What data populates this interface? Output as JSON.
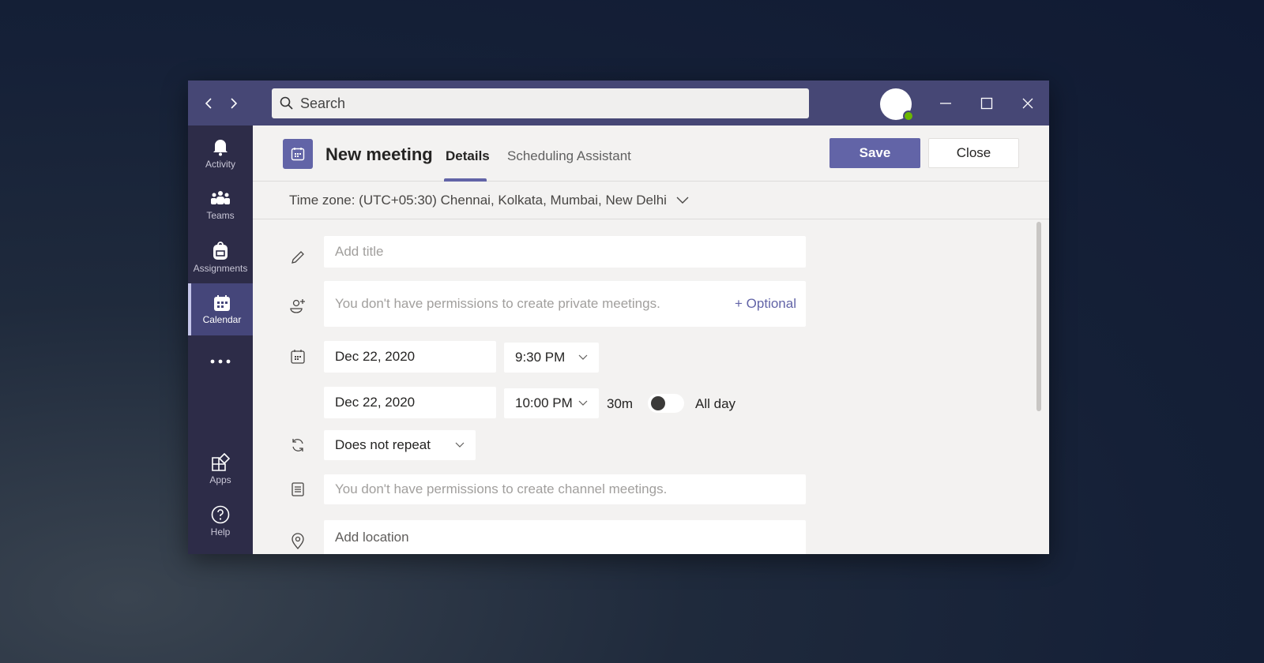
{
  "titlebar": {
    "back_label": "Back",
    "forward_label": "Forward",
    "search_placeholder": "Search",
    "presence_status": "Available",
    "window_controls": [
      "minimize",
      "maximize",
      "close"
    ]
  },
  "rail": {
    "items": [
      {
        "label": "Activity",
        "icon": "bell-icon"
      },
      {
        "label": "Teams",
        "icon": "teams-icon"
      },
      {
        "label": "Assignments",
        "icon": "backpack-icon"
      },
      {
        "label": "Calendar",
        "icon": "calendar-icon",
        "active": true
      },
      {
        "label": "More",
        "icon": "more-icon"
      },
      {
        "label": "Apps",
        "icon": "apps-icon"
      },
      {
        "label": "Help",
        "icon": "help-icon"
      }
    ]
  },
  "header": {
    "title": "New meeting",
    "tabs": [
      {
        "label": "Details",
        "active": true
      },
      {
        "label": "Scheduling Assistant",
        "active": false
      }
    ],
    "save_label": "Save",
    "close_label": "Close"
  },
  "timezone": {
    "label": "Time zone: (UTC+05:30) Chennai, Kolkata, Mumbai, New Delhi"
  },
  "form": {
    "title_placeholder": "Add title",
    "attendees_placeholder": "You don't have permissions to create private meetings.",
    "optional_label": "+ Optional",
    "start_date": "Dec 22, 2020",
    "start_time": "9:30 PM",
    "end_date": "Dec 22, 2020",
    "end_time": "10:00 PM",
    "duration": "30m",
    "all_day_label": "All day",
    "all_day_on": false,
    "repeat": "Does not repeat",
    "channel_placeholder": "You don't have permissions to create channel meetings.",
    "location_placeholder": "Add location"
  },
  "colors": {
    "brand": "#6264a7",
    "titlebar": "#464775",
    "rail": "#2d2c48",
    "presence": "#6bb700"
  }
}
